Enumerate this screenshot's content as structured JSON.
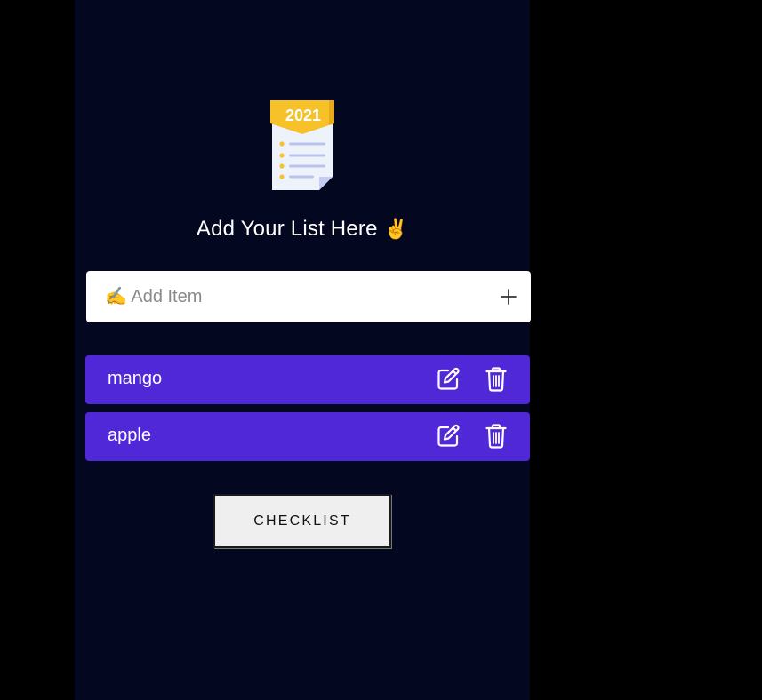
{
  "logo": {
    "icon": "checklist-2021-icon",
    "year": "2021"
  },
  "heading": {
    "text": "Add Your List Here",
    "emoji": "✌"
  },
  "add_input": {
    "placeholder": "✍️ Add Item",
    "value": ""
  },
  "add_button": {
    "icon": "plus-icon"
  },
  "items": [
    {
      "label": "mango"
    },
    {
      "label": "apple"
    }
  ],
  "checklist_button": {
    "label": "CHECKLIST"
  },
  "colors": {
    "page_background": "#000000",
    "app_background": "#040720",
    "item_background": "#5128d8",
    "logo_yellow": "#f7c12a"
  }
}
